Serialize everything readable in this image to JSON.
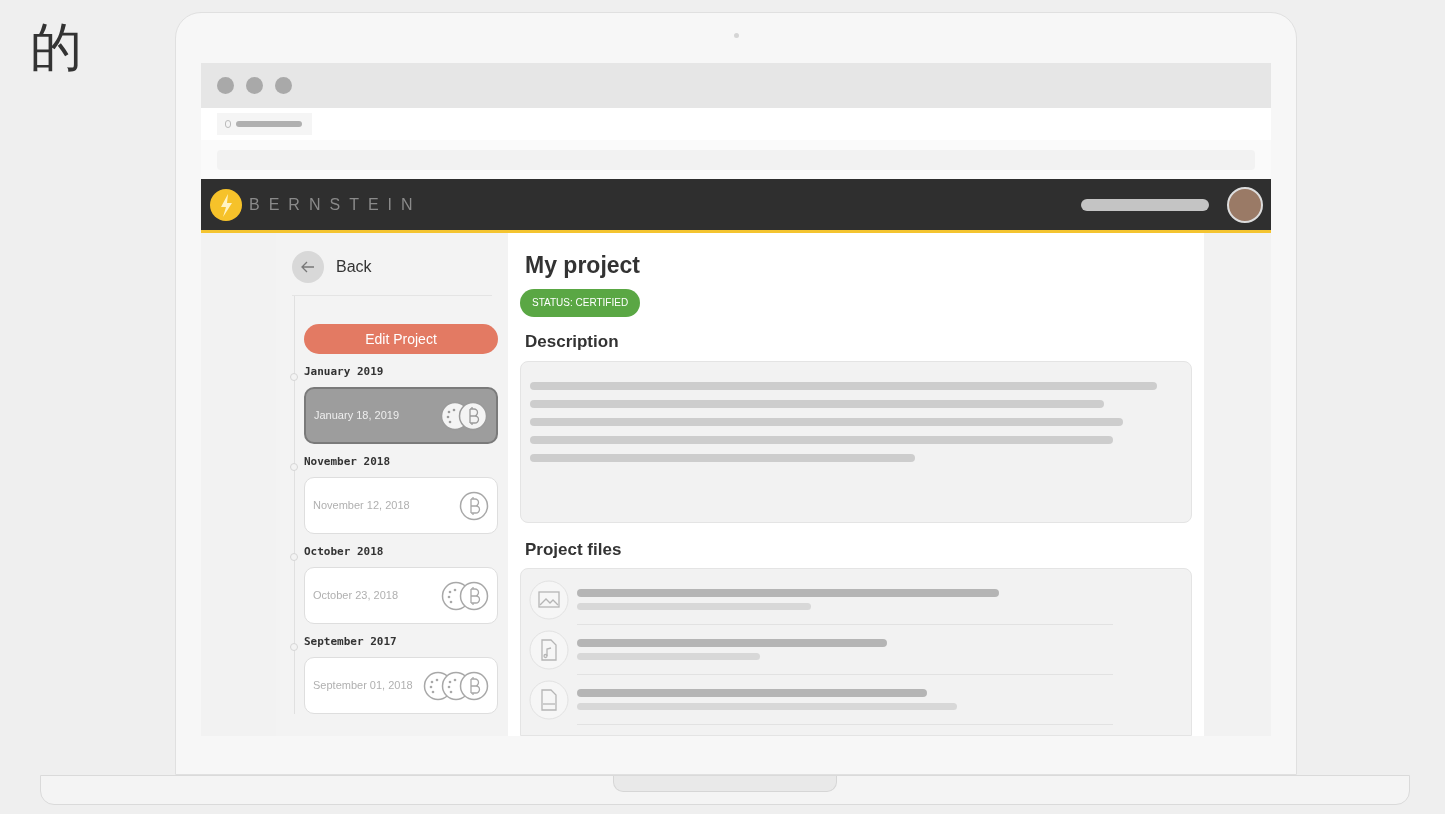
{
  "caption": "的",
  "app": {
    "brand": "BERNSTEIN"
  },
  "sidebar": {
    "back": "Back",
    "edit_button": "Edit Project",
    "timeline": [
      {
        "month": "January 2019",
        "date": "January 18, 2019",
        "selected": true,
        "coins": [
          {
            "kind": "dots"
          },
          {
            "kind": "bitcoin"
          }
        ]
      },
      {
        "month": "November 2018",
        "date": "November 12, 2018",
        "selected": false,
        "coins": [
          {
            "kind": "bitcoin"
          }
        ]
      },
      {
        "month": "October 2018",
        "date": "October 23, 2018",
        "selected": false,
        "coins": [
          {
            "kind": "dots"
          },
          {
            "kind": "bitcoin"
          }
        ]
      },
      {
        "month": "September 2017",
        "date": "September 01, 2018",
        "selected": false,
        "coins": [
          {
            "kind": "dots"
          },
          {
            "kind": "dots"
          },
          {
            "kind": "bitcoin"
          }
        ]
      }
    ]
  },
  "main": {
    "title": "My project",
    "status": "STATUS: CERTIFIED",
    "description_heading": "Description",
    "files_heading": "Project files",
    "files": [
      {
        "kind": "image"
      },
      {
        "kind": "audio"
      },
      {
        "kind": "disk"
      }
    ]
  }
}
